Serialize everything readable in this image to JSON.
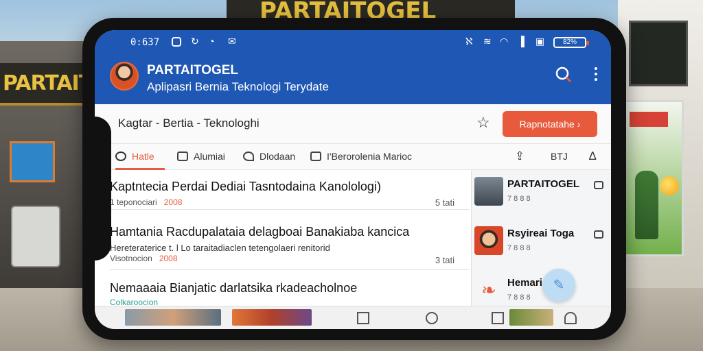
{
  "background": {
    "left_sign": "PARTAITOGEL",
    "top_sign": "PARTAITOGEL"
  },
  "status_bar": {
    "time": "0:637",
    "battery": "82%"
  },
  "header": {
    "title": "PARTAITOGEL",
    "subtitle": "Aplipasri Bernia Teknologi Terydate",
    "search_icon": "search-icon",
    "more_icon": "more-vertical-icon"
  },
  "subheader": {
    "breadcrumb": "Kagtar - Bertia - Teknologhi",
    "action_label": "Rapnotatahe",
    "action_arrow": "›"
  },
  "tabs": [
    {
      "label": "Hatle",
      "active": true
    },
    {
      "label": "Alumiai"
    },
    {
      "label": "Dlodaan"
    },
    {
      "label": "I'Berorolenia Marioc"
    }
  ],
  "tab_right": {
    "label": "BTJ"
  },
  "articles": [
    {
      "title": "Kaptntecia Perdai Dediai Tasntodaina Kanolologi)",
      "meta": "1 teponociari",
      "highlight": "2008",
      "time": "5 tati"
    },
    {
      "title": "Hamtania Racdupalataia delagboai Banakiaba kancica",
      "desc1": "Hereteraterice t. l Lo taraitadiaclen tetengolaeri renitorid",
      "desc2": "Visotnocion",
      "highlight": "2008",
      "time": "3 tati"
    },
    {
      "title": "Nemaaaia Bianjatic darlatsika rkadeacholnoe",
      "meta": "Colkaroocion"
    }
  ],
  "side_panel": [
    {
      "name": "PARTAITOGEL",
      "count": "7 8 8 8"
    },
    {
      "name": "Rsyireai Toga",
      "count": "7 8 8 8"
    },
    {
      "name": "Hemari",
      "count": "7 8 8 8"
    }
  ],
  "fab_icon": "compose-icon"
}
